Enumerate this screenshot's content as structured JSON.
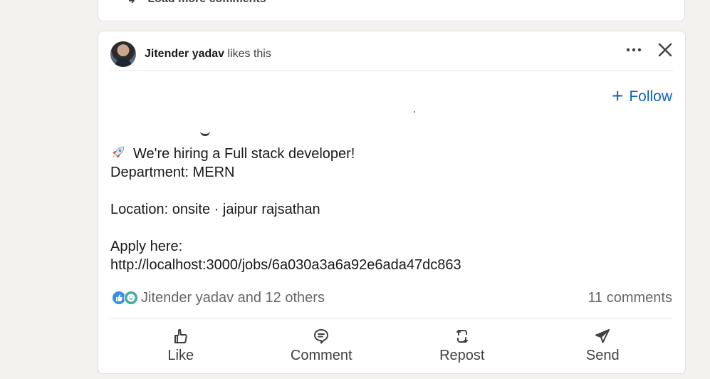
{
  "previous_card": {
    "load_more_label": "Load more comments"
  },
  "post": {
    "header": {
      "actor_name": "Jitender yadav",
      "activity_text": " likes this"
    },
    "follow_label": "Follow",
    "body": {
      "line1": "We're hiring a Full stack developer!",
      "line2": "Department: MERN",
      "line3": "Location: onsite · jaipur rajsathan",
      "line4": "Apply here:",
      "line5": "http://localhost:3000/jobs/6a030a3a6a92e6ada47dc863"
    },
    "social": {
      "reactions_text": "Jitender yadav and 12 others",
      "comments_text": "11 comments"
    },
    "actions": {
      "like": "Like",
      "comment": "Comment",
      "repost": "Repost",
      "send": "Send"
    }
  },
  "icons": {
    "more": "ellipsis-icon",
    "close": "close-icon",
    "follow": "plus-icon",
    "rocket": "rocket-icon",
    "like": "thumbs-up-icon",
    "comment": "speech-bubble-icon",
    "repost": "repost-arrows-icon",
    "send": "paper-plane-icon"
  },
  "colors": {
    "page_background": "#f4f2ee",
    "card_background": "#ffffff",
    "accent": "#0a66c2",
    "muted_text": "#666666",
    "like_reaction": "#378fe9",
    "funny_reaction": "#44a9a0"
  }
}
